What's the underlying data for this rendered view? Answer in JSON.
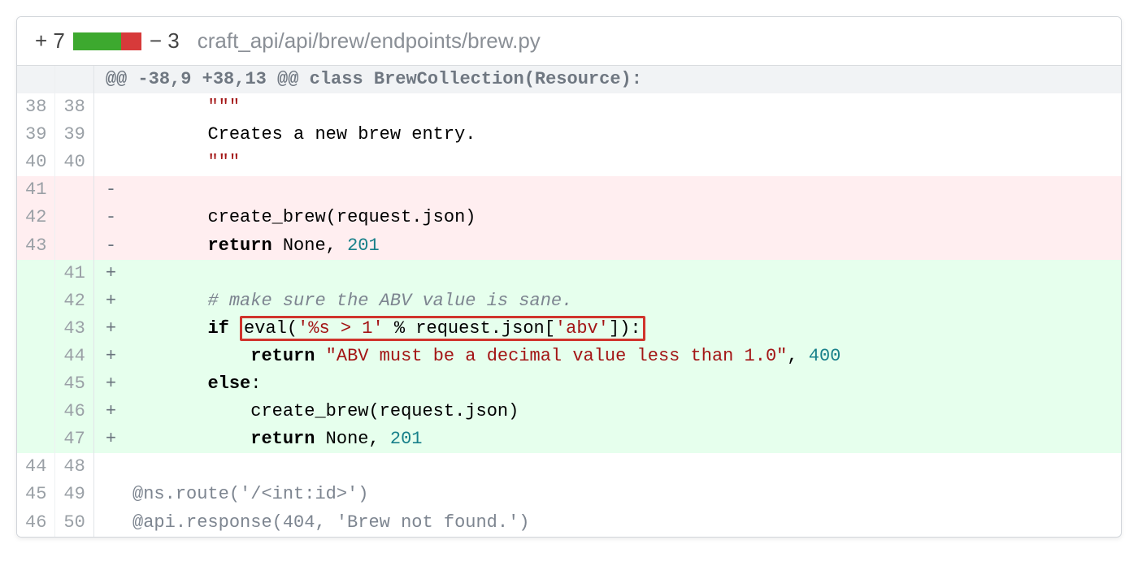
{
  "header": {
    "additions": "+ 7",
    "deletions": "− 3",
    "file_path": "craft_api/api/brew/endpoints/brew.py",
    "bar_green_flex": "7",
    "bar_red_flex": "3"
  },
  "hunk": {
    "text": "@@ -38,9 +38,13 @@ class BrewCollection(Resource):"
  },
  "rows": [
    {
      "old": "38",
      "new": "38",
      "kind": "ctx",
      "sign": " ",
      "code": {
        "prefix": "        ",
        "segments": [
          {
            "cls": "tok-str",
            "text": "\"\"\""
          }
        ]
      }
    },
    {
      "old": "39",
      "new": "39",
      "kind": "ctx",
      "sign": " ",
      "code": {
        "prefix": "        ",
        "segments": [
          {
            "cls": "",
            "text": "Creates a new brew entry."
          }
        ]
      }
    },
    {
      "old": "40",
      "new": "40",
      "kind": "ctx",
      "sign": " ",
      "code": {
        "prefix": "        ",
        "segments": [
          {
            "cls": "tok-str",
            "text": "\"\"\""
          }
        ]
      }
    },
    {
      "old": "41",
      "new": "",
      "kind": "del",
      "sign": "-",
      "code": {
        "prefix": "",
        "segments": []
      }
    },
    {
      "old": "42",
      "new": "",
      "kind": "del",
      "sign": "-",
      "code": {
        "prefix": "        ",
        "segments": [
          {
            "cls": "",
            "text": "create_brew(request.json)"
          }
        ]
      }
    },
    {
      "old": "43",
      "new": "",
      "kind": "del",
      "sign": "-",
      "code": {
        "prefix": "        ",
        "segments": [
          {
            "cls": "tok-kw",
            "text": "return"
          },
          {
            "cls": "",
            "text": " None, "
          },
          {
            "cls": "tok-num",
            "text": "201"
          }
        ]
      }
    },
    {
      "old": "",
      "new": "41",
      "kind": "add",
      "sign": "+",
      "code": {
        "prefix": "",
        "segments": []
      }
    },
    {
      "old": "",
      "new": "42",
      "kind": "add",
      "sign": "+",
      "code": {
        "prefix": "        ",
        "segments": [
          {
            "cls": "tok-cmt",
            "text": "# make sure the ABV value is sane."
          }
        ]
      }
    },
    {
      "old": "",
      "new": "43",
      "kind": "add",
      "sign": "+",
      "code": {
        "prefix": "        ",
        "segments": [
          {
            "cls": "tok-kw",
            "text": "if"
          },
          {
            "cls": "",
            "text": " "
          },
          {
            "cls": "highlight-box",
            "parts": [
              {
                "cls": "",
                "text": "eval("
              },
              {
                "cls": "tok-str",
                "text": "'%s > 1'"
              },
              {
                "cls": "",
                "text": " % request.json["
              },
              {
                "cls": "tok-str",
                "text": "'abv'"
              },
              {
                "cls": "",
                "text": "]):"
              }
            ]
          }
        ]
      }
    },
    {
      "old": "",
      "new": "44",
      "kind": "add",
      "sign": "+",
      "code": {
        "prefix": "            ",
        "segments": [
          {
            "cls": "tok-kw",
            "text": "return"
          },
          {
            "cls": "",
            "text": " "
          },
          {
            "cls": "tok-str",
            "text": "\"ABV must be a decimal value less than 1.0\""
          },
          {
            "cls": "",
            "text": ", "
          },
          {
            "cls": "tok-num",
            "text": "400"
          }
        ]
      }
    },
    {
      "old": "",
      "new": "45",
      "kind": "add",
      "sign": "+",
      "code": {
        "prefix": "        ",
        "segments": [
          {
            "cls": "tok-kw",
            "text": "else"
          },
          {
            "cls": "",
            "text": ":"
          }
        ]
      }
    },
    {
      "old": "",
      "new": "46",
      "kind": "add",
      "sign": "+",
      "code": {
        "prefix": "            ",
        "segments": [
          {
            "cls": "",
            "text": "create_brew(request.json)"
          }
        ]
      }
    },
    {
      "old": "",
      "new": "47",
      "kind": "add",
      "sign": "+",
      "code": {
        "prefix": "            ",
        "segments": [
          {
            "cls": "tok-kw",
            "text": "return"
          },
          {
            "cls": "",
            "text": " None, "
          },
          {
            "cls": "tok-num",
            "text": "201"
          }
        ]
      }
    },
    {
      "old": "44",
      "new": "48",
      "kind": "ctx",
      "sign": " ",
      "code": {
        "prefix": "",
        "segments": []
      }
    },
    {
      "old": "45",
      "new": "49",
      "kind": "ctx",
      "sign": " ",
      "code": {
        "prefix": " ",
        "segments": [
          {
            "cls": "tok-route",
            "text": "@ns.route('/<int:id>')"
          }
        ]
      }
    },
    {
      "old": "46",
      "new": "50",
      "kind": "ctx",
      "sign": " ",
      "code": {
        "prefix": " ",
        "segments": [
          {
            "cls": "tok-route",
            "text": "@api.response(404, 'Brew not found.')"
          }
        ]
      }
    }
  ]
}
